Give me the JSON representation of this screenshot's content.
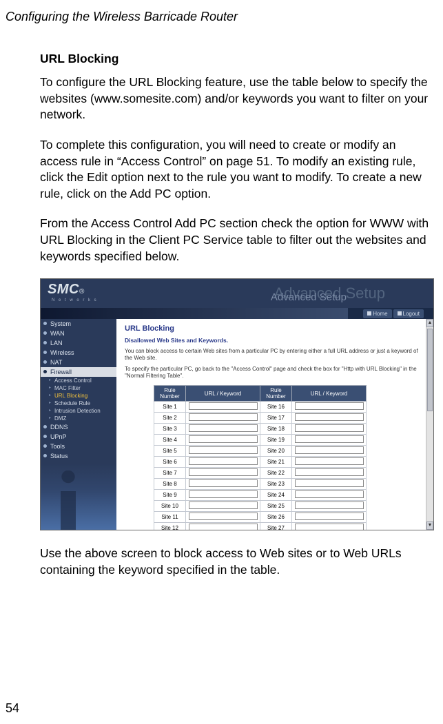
{
  "page": {
    "running_head": "Configuring the Wireless Barricade Router",
    "number": "54"
  },
  "doc": {
    "heading": "URL Blocking",
    "p1": "To configure the URL Blocking feature, use the table below to specify the websites (www.somesite.com) and/or keywords you want to filter on your network.",
    "p2": "To complete this configuration, you will need to create or modify an access rule in “Access Control” on page 51. To modify an existing rule, click the Edit option next to the rule you want to modify. To create a new rule, click on the Add PC option.",
    "p3": "From the Access Control Add PC section check the option for WWW with URL Blocking in the Client PC Service table to filter out the websites and keywords specified below.",
    "p4": "Use the above screen to block access to Web sites or to Web URLs containing the keyword specified in the table."
  },
  "ui": {
    "brand": "SMC",
    "brand_reg": "®",
    "brand_sub": "N e t w o r k s",
    "adv_bg": "Advanced Setup",
    "adv_fg": "Advanced Setup",
    "home_btn": "Home",
    "logout_btn": "Logout",
    "sidebar": {
      "items": [
        {
          "label": "System"
        },
        {
          "label": "WAN"
        },
        {
          "label": "LAN"
        },
        {
          "label": "Wireless"
        },
        {
          "label": "NAT"
        },
        {
          "label": "Firewall"
        }
      ],
      "subs": [
        {
          "label": "Access Control"
        },
        {
          "label": "MAC Filter"
        },
        {
          "label": "URL Blocking"
        },
        {
          "label": "Schedule Rule"
        },
        {
          "label": "Intrusion Detection"
        },
        {
          "label": "DMZ"
        }
      ],
      "tail": [
        {
          "label": "DDNS"
        },
        {
          "label": "UPnP"
        },
        {
          "label": "Tools"
        },
        {
          "label": "Status"
        }
      ]
    },
    "main": {
      "title": "URL Blocking",
      "subtitle": "Disallowed Web Sites and Keywords.",
      "desc1": "You can block access to certain Web sites from a particular PC by entering either a full URL address or just a keyword of the Web site.",
      "desc2": "To specify the particular PC, go back to the \"Access Control\" page and check the box for \"Http with URL Blocking\" in the \"Normal Filtering Table\"."
    },
    "table": {
      "h_rule": "Rule Number",
      "h_url": "URL / Keyword",
      "left": [
        "Site  1",
        "Site  2",
        "Site  3",
        "Site  4",
        "Site  5",
        "Site  6",
        "Site  7",
        "Site  8",
        "Site  9",
        "Site  10",
        "Site  11",
        "Site  12"
      ],
      "right": [
        "Site  16",
        "Site  17",
        "Site  18",
        "Site  19",
        "Site  20",
        "Site  21",
        "Site  22",
        "Site  23",
        "Site  24",
        "Site  25",
        "Site  26",
        "Site  27"
      ]
    }
  }
}
